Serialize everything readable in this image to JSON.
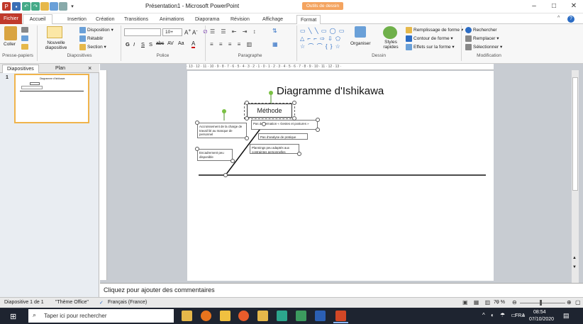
{
  "window": {
    "title": "Présentation1 - Microsoft PowerPoint",
    "context_tab": "Outils de dessin",
    "controls": [
      "–",
      "□",
      "✕"
    ]
  },
  "ribbon_tabs": [
    "Fichier",
    "Accueil",
    "Insertion",
    "Création",
    "Transitions",
    "Animations",
    "Diaporama",
    "Révision",
    "Affichage",
    "Format"
  ],
  "ribbon": {
    "clipboard": {
      "paste": "Coller",
      "group": "Presse-papiers"
    },
    "slides": {
      "new_slide": "Nouvelle diapositive",
      "layout": "Disposition",
      "reset": "Rétablir",
      "section": "Section",
      "group": "Diapositives"
    },
    "font": {
      "size": "10+",
      "bold": "G",
      "italic": "I",
      "underline": "S",
      "strike": "S",
      "shadow": "abc",
      "spacing": "AV",
      "case": "Aa",
      "color_a": "A",
      "group": "Police"
    },
    "paragraph": {
      "group": "Paragraphe"
    },
    "drawing": {
      "arrange": "Organiser",
      "styles": "Styles rapides",
      "fill": "Remplissage de forme",
      "outline": "Contour de forme",
      "effects": "Effets sur la forme",
      "group": "Dessin"
    },
    "editing": {
      "find": "Rechercher",
      "replace": "Remplacer",
      "select": "Sélectionner",
      "group": "Modification"
    }
  },
  "panel": {
    "tab_slides": "Diapositives",
    "tab_outline": "Plan",
    "close": "×",
    "slide_number": "1",
    "thumb_title": "Diagramme d'Ishikawa"
  },
  "ruler": {
    "horizontal": "· 13 · 12 · 11 · 10 · 9 · 8 · 7 · 6 · 5 · 4 · 3 · 2 · 1 · 0 · 1 · 2 · 3 · 4 · 5 · 6 · 7 · 8 · 9 · 10 · 11 · 12 · 13 ·"
  },
  "slide": {
    "title": "Diagramme d'Ishikawa",
    "method": "Méthode",
    "box_overload": "Accroissement de la charge de travail lié au manque de personnel",
    "box_training": "Pas de formation « Gestes et postures »",
    "box_analysis": "Pas d'analyse de pratique",
    "box_schedule": "Plannings peu adaptés aux contraintes personnelles",
    "box_supervision": "Encadrement peu disponible"
  },
  "notes": {
    "placeholder": "Cliquez pour ajouter des commentaires"
  },
  "status": {
    "slide": "Diapositive 1 de 1",
    "theme": "\"Thème Office\"",
    "language": "Français (France)",
    "zoom": "70 %"
  },
  "taskbar": {
    "search": "Taper ici pour rechercher",
    "lang": "FRA",
    "time": "08:54",
    "date": "07/10/2020"
  },
  "colors": {
    "accent": "#c0392b",
    "context": "#f4a460",
    "taskbar": "#1e2430",
    "selection": "#f0b44c"
  }
}
